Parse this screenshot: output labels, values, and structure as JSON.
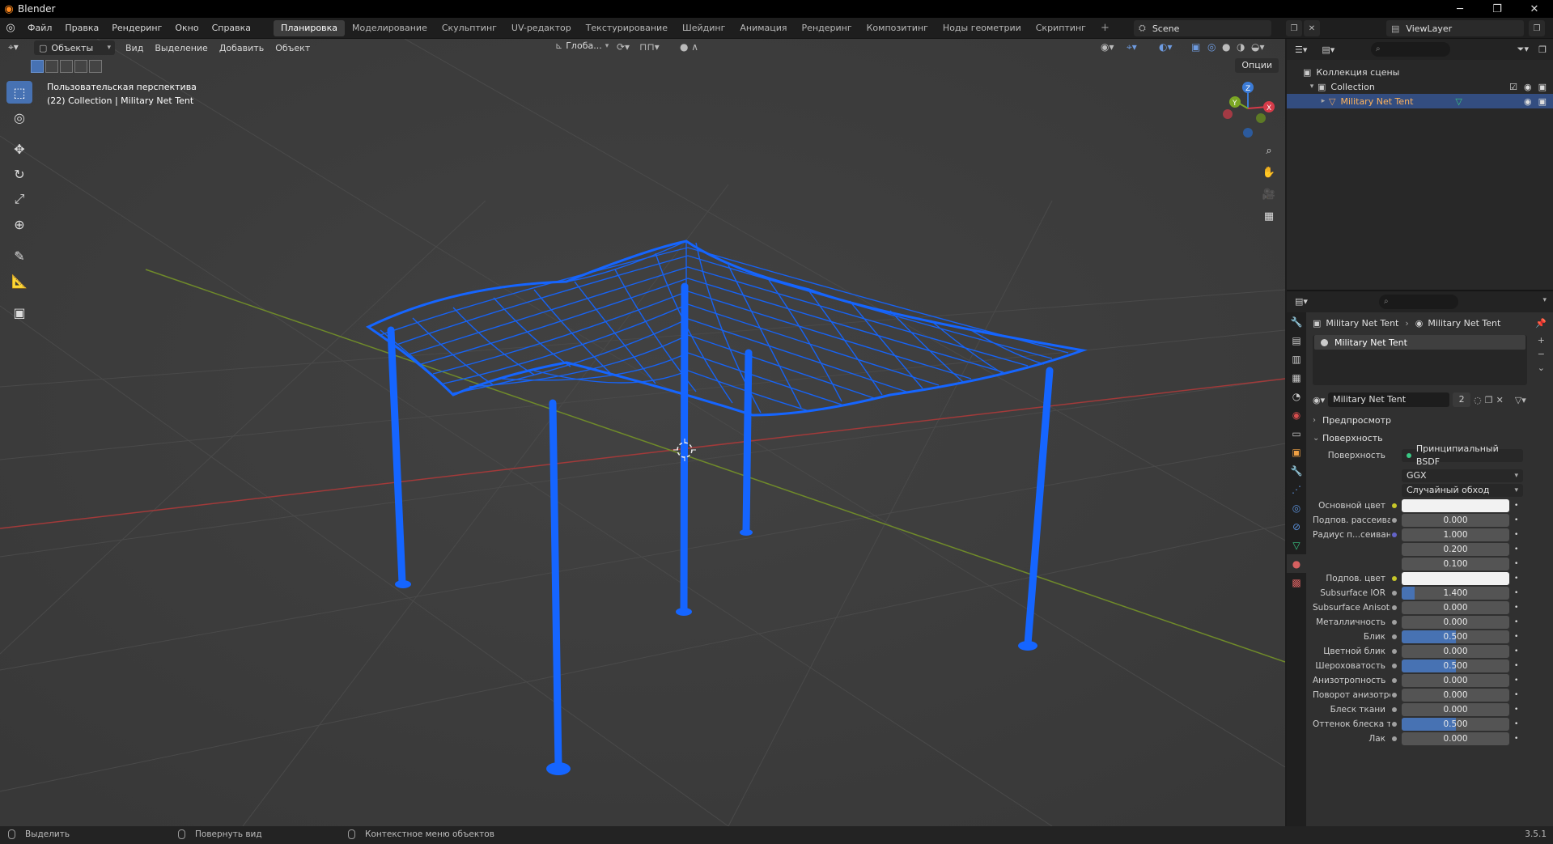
{
  "window": {
    "title": "Blender",
    "controls": [
      "─",
      "❐",
      "✕"
    ]
  },
  "menubar": {
    "items": [
      "Файл",
      "Правка",
      "Рендеринг",
      "Окно",
      "Справка"
    ],
    "workspaces": [
      "Планировка",
      "Моделирование",
      "Скульптинг",
      "UV-редактор",
      "Текстурирование",
      "Шейдинг",
      "Анимация",
      "Рендеринг",
      "Композитинг",
      "Ноды геометрии",
      "Скриптинг"
    ],
    "active_workspace": "Планировка",
    "add_workspace": "+",
    "scene": "Scene",
    "view_layer": "ViewLayer"
  },
  "viewport": {
    "mode": "Объекты",
    "menus": [
      "Вид",
      "Выделение",
      "Добавить",
      "Объект"
    ],
    "transform_orientation": "Глоба...",
    "options": "Опции",
    "info_line1": "Пользовательская перспектива",
    "info_line2": "(22) Collection | Military Net Tent",
    "gizmo_axes": {
      "x": "X",
      "y": "Y",
      "z": "Z"
    },
    "object_color": "#1565ff"
  },
  "outliner": {
    "search_placeholder": "",
    "scene_collection": "Коллекция сцены",
    "collection": "Collection",
    "object": "Military Net Tent"
  },
  "properties": {
    "breadcrumb_object": "Military Net Tent",
    "breadcrumb_material": "Military Net Tent",
    "slot_name": "Military Net Tent",
    "material_name": "Military Net Tent",
    "material_users": "2",
    "panel_preview": "Предпросмотр",
    "panel_surface": "Поверхность",
    "surface_label": "Поверхность",
    "surface_shader": "Принципиальный BSDF",
    "distribution": "GGX",
    "subsurface_method": "Случайный обход",
    "rows": [
      {
        "label": "Основной цвет",
        "value": "",
        "type": "color",
        "socket": "#c7c729"
      },
      {
        "label": "Подпов. рассеива...",
        "value": "0.000",
        "type": "num",
        "socket": "#a0a0a0",
        "fill": 0
      },
      {
        "label": "Радиус п...сеивания",
        "value": "1.000",
        "type": "num",
        "socket": "#6363c7",
        "fill": 0
      },
      {
        "label": "",
        "value": "0.200",
        "type": "num",
        "socket": "",
        "fill": 0
      },
      {
        "label": "",
        "value": "0.100",
        "type": "num",
        "socket": "",
        "fill": 0
      },
      {
        "label": "Подпов. цвет",
        "value": "",
        "type": "color",
        "socket": "#c7c729"
      },
      {
        "label": "Subsurface IOR",
        "value": "1.400",
        "type": "num",
        "socket": "#a0a0a0",
        "fill": 0.12
      },
      {
        "label": "Subsurface Anisotr...",
        "value": "0.000",
        "type": "num",
        "socket": "#a0a0a0",
        "fill": 0
      },
      {
        "label": "Металличность",
        "value": "0.000",
        "type": "num",
        "socket": "#a0a0a0",
        "fill": 0
      },
      {
        "label": "Блик",
        "value": "0.500",
        "type": "num",
        "socket": "#a0a0a0",
        "fill": 0.5
      },
      {
        "label": "Цветной блик",
        "value": "0.000",
        "type": "num",
        "socket": "#a0a0a0",
        "fill": 0
      },
      {
        "label": "Шероховатость",
        "value": "0.500",
        "type": "num",
        "socket": "#a0a0a0",
        "fill": 0.5
      },
      {
        "label": "Анизотропность",
        "value": "0.000",
        "type": "num",
        "socket": "#a0a0a0",
        "fill": 0
      },
      {
        "label": "Поворот анизотро...",
        "value": "0.000",
        "type": "num",
        "socket": "#a0a0a0",
        "fill": 0
      },
      {
        "label": "Блеск ткани",
        "value": "0.000",
        "type": "num",
        "socket": "#a0a0a0",
        "fill": 0
      },
      {
        "label": "Оттенок блеска тк...",
        "value": "0.500",
        "type": "num",
        "socket": "#a0a0a0",
        "fill": 0.5
      },
      {
        "label": "Лак",
        "value": "0.000",
        "type": "num",
        "socket": "#a0a0a0",
        "fill": 0
      }
    ]
  },
  "statusbar": {
    "select": "Выделить",
    "rotate": "Повернуть вид",
    "context": "Контекстное меню объектов",
    "version": "3.5.1"
  }
}
